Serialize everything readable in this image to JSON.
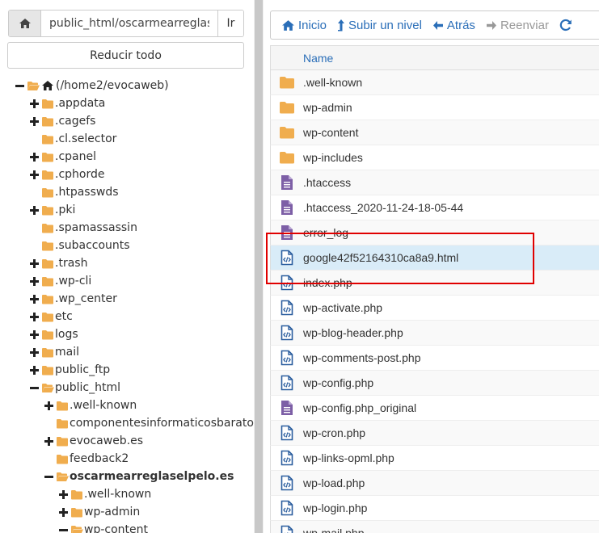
{
  "left_pane": {
    "path_value": "public_html/oscarmearreglaselpelo.es",
    "go_label": "Ir",
    "collapse_label": "Reducir todo",
    "tree": [
      {
        "label": "(/home2/evocaweb)",
        "depth": 0,
        "toggle": "minus",
        "icon": "home",
        "bold": false
      },
      {
        "label": ".appdata",
        "depth": 1,
        "toggle": "plus",
        "icon": "folder",
        "bold": false
      },
      {
        "label": ".cagefs",
        "depth": 1,
        "toggle": "plus",
        "icon": "folder",
        "bold": false
      },
      {
        "label": ".cl.selector",
        "depth": 1,
        "toggle": "none",
        "icon": "folder",
        "bold": false
      },
      {
        "label": ".cpanel",
        "depth": 1,
        "toggle": "plus",
        "icon": "folder",
        "bold": false
      },
      {
        "label": ".cphorde",
        "depth": 1,
        "toggle": "plus",
        "icon": "folder",
        "bold": false
      },
      {
        "label": ".htpasswds",
        "depth": 1,
        "toggle": "none",
        "icon": "folder",
        "bold": false
      },
      {
        "label": ".pki",
        "depth": 1,
        "toggle": "plus",
        "icon": "folder",
        "bold": false
      },
      {
        "label": ".spamassassin",
        "depth": 1,
        "toggle": "none",
        "icon": "folder",
        "bold": false
      },
      {
        "label": ".subaccounts",
        "depth": 1,
        "toggle": "none",
        "icon": "folder",
        "bold": false
      },
      {
        "label": ".trash",
        "depth": 1,
        "toggle": "plus",
        "icon": "folder",
        "bold": false
      },
      {
        "label": ".wp-cli",
        "depth": 1,
        "toggle": "plus",
        "icon": "folder",
        "bold": false
      },
      {
        "label": ".wp_center",
        "depth": 1,
        "toggle": "plus",
        "icon": "folder",
        "bold": false
      },
      {
        "label": "etc",
        "depth": 1,
        "toggle": "plus",
        "icon": "folder",
        "bold": false
      },
      {
        "label": "logs",
        "depth": 1,
        "toggle": "plus",
        "icon": "folder",
        "bold": false
      },
      {
        "label": "mail",
        "depth": 1,
        "toggle": "plus",
        "icon": "folder",
        "bold": false
      },
      {
        "label": "public_ftp",
        "depth": 1,
        "toggle": "plus",
        "icon": "folder",
        "bold": false
      },
      {
        "label": "public_html",
        "depth": 1,
        "toggle": "minus",
        "icon": "folder-open",
        "bold": false
      },
      {
        "label": ".well-known",
        "depth": 2,
        "toggle": "plus",
        "icon": "folder",
        "bold": false
      },
      {
        "label": "componentesinformaticosbaratos.es",
        "depth": 2,
        "toggle": "none",
        "icon": "folder",
        "bold": false
      },
      {
        "label": "evocaweb.es",
        "depth": 2,
        "toggle": "plus",
        "icon": "folder",
        "bold": false
      },
      {
        "label": "feedback2",
        "depth": 2,
        "toggle": "none",
        "icon": "folder",
        "bold": false
      },
      {
        "label": "oscarmearreglaselpelo.es",
        "depth": 2,
        "toggle": "minus",
        "icon": "folder-open",
        "bold": true
      },
      {
        "label": ".well-known",
        "depth": 3,
        "toggle": "plus",
        "icon": "folder",
        "bold": false
      },
      {
        "label": "wp-admin",
        "depth": 3,
        "toggle": "plus",
        "icon": "folder",
        "bold": false
      },
      {
        "label": "wp-content",
        "depth": 3,
        "toggle": "minus",
        "icon": "folder-open",
        "bold": false
      }
    ]
  },
  "toolbar": {
    "home_label": "Inicio",
    "up_label": "Subir un nivel",
    "back_label": "Atrás",
    "forward_label": "Reenviar"
  },
  "file_table": {
    "header_name": "Name",
    "rows": [
      {
        "name": ".well-known",
        "icon": "folder",
        "selected": false
      },
      {
        "name": "wp-admin",
        "icon": "folder",
        "selected": false
      },
      {
        "name": "wp-content",
        "icon": "folder",
        "selected": false
      },
      {
        "name": "wp-includes",
        "icon": "folder",
        "selected": false
      },
      {
        "name": ".htaccess",
        "icon": "text-file",
        "selected": false
      },
      {
        "name": ".htaccess_2020-11-24-18-05-44",
        "icon": "text-file",
        "selected": false
      },
      {
        "name": "error_log",
        "icon": "text-file",
        "selected": false
      },
      {
        "name": "google42f52164310ca8a9.html",
        "icon": "code-file",
        "selected": true
      },
      {
        "name": "index.php",
        "icon": "code-file",
        "selected": false
      },
      {
        "name": "wp-activate.php",
        "icon": "code-file",
        "selected": false
      },
      {
        "name": "wp-blog-header.php",
        "icon": "code-file",
        "selected": false
      },
      {
        "name": "wp-comments-post.php",
        "icon": "code-file",
        "selected": false
      },
      {
        "name": "wp-config.php",
        "icon": "code-file",
        "selected": false
      },
      {
        "name": "wp-config.php_original",
        "icon": "text-file",
        "selected": false
      },
      {
        "name": "wp-cron.php",
        "icon": "code-file",
        "selected": false
      },
      {
        "name": "wp-links-opml.php",
        "icon": "code-file",
        "selected": false
      },
      {
        "name": "wp-load.php",
        "icon": "code-file",
        "selected": false
      },
      {
        "name": "wp-login.php",
        "icon": "code-file",
        "selected": false
      },
      {
        "name": "wp-mail.php",
        "icon": "code-file",
        "selected": false
      }
    ]
  },
  "colors": {
    "folder": "#f0ad4e",
    "link": "#2a6eb8",
    "text_file": "#7d5fa6",
    "code_file": "#2a5d9e",
    "highlight": "#e00000",
    "selected_row": "#d9ecf8"
  }
}
